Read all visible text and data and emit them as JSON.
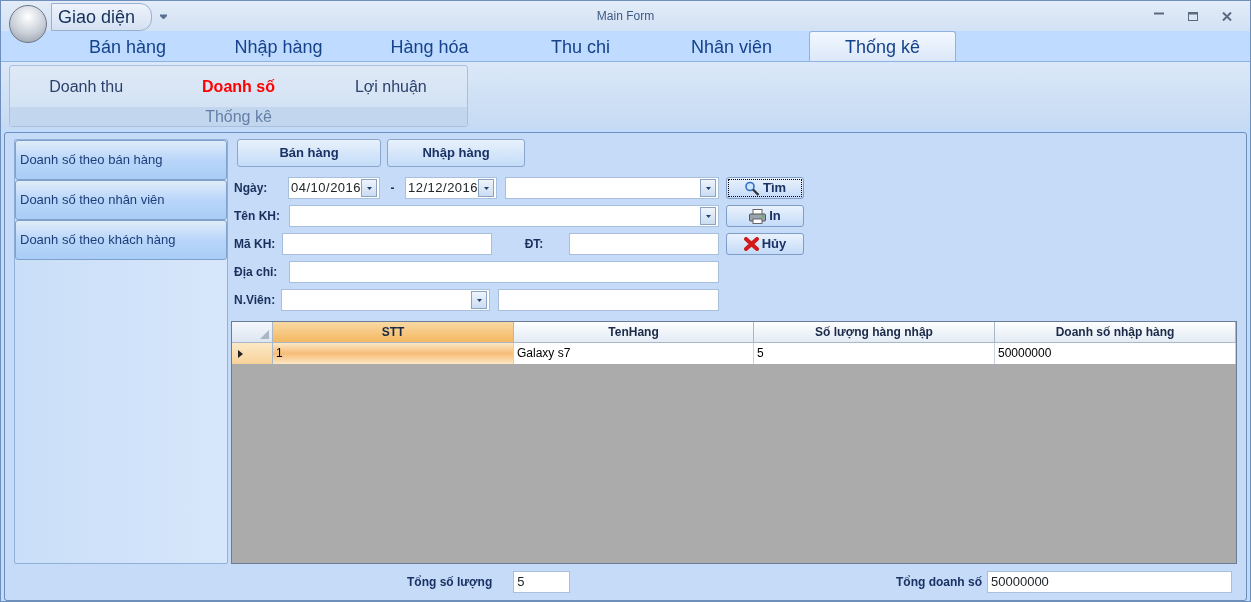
{
  "window": {
    "title": "Main Form",
    "quick_access": "Giao diện"
  },
  "ribbon_tabs": [
    {
      "label": "Bán hàng",
      "selected": false
    },
    {
      "label": "Nhập hàng",
      "selected": false
    },
    {
      "label": "Hàng hóa",
      "selected": false
    },
    {
      "label": "Thu chi",
      "selected": false
    },
    {
      "label": "Nhân viên",
      "selected": false
    },
    {
      "label": "Thống kê",
      "selected": true
    }
  ],
  "ribbon_group": {
    "label": "Thống kê",
    "buttons": [
      {
        "label": "Doanh thu",
        "selected": false
      },
      {
        "label": "Doanh số",
        "selected": true
      },
      {
        "label": "Lợi nhuận",
        "selected": false
      }
    ]
  },
  "sidebar": {
    "items": [
      "Doanh số theo bán hàng",
      "Doanh số theo nhân viên",
      "Doanh số theo khách hàng"
    ]
  },
  "mode_buttons": [
    "Bán hàng",
    "Nhập hàng"
  ],
  "form": [
    {
      "label": "Ngày:",
      "fields": [
        {
          "kind": "date",
          "value": "04/10/2016"
        },
        {
          "kind": "text_label",
          "text": "-"
        },
        {
          "kind": "date",
          "value": "12/12/2016"
        },
        {
          "kind": "combo"
        }
      ]
    },
    {
      "label": "Tên KH:",
      "fields": [
        {
          "kind": "combo"
        }
      ]
    },
    {
      "label": "Mã KH:",
      "fields": [
        {
          "kind": "input"
        },
        {
          "kind": "text_label",
          "text": "ĐT:"
        },
        {
          "kind": "input"
        }
      ]
    },
    {
      "label": "Địa chỉ:",
      "fields": [
        {
          "kind": "input"
        }
      ]
    },
    {
      "label": "N.Viên:",
      "fields": [
        {
          "kind": "combo"
        },
        {
          "kind": "input"
        }
      ]
    }
  ],
  "actions": [
    {
      "kind": "search",
      "label": "Tìm",
      "focused": true
    },
    {
      "kind": "print",
      "label": "In",
      "focused": false
    },
    {
      "kind": "cancel",
      "label": "Hủy",
      "focused": false
    }
  ],
  "table": {
    "columns": [
      "STT",
      "TenHang",
      "Số lượng hàng nhập",
      "Doanh số nhập hàng"
    ],
    "rows": [
      {
        "selected": true,
        "cells": [
          "1",
          "Galaxy s7",
          "5",
          "50000000"
        ]
      }
    ]
  },
  "totals": [
    {
      "label": "Tổng số lượng",
      "value": "5"
    },
    {
      "label": "Tổng doanh số",
      "value": "50000000"
    }
  ]
}
